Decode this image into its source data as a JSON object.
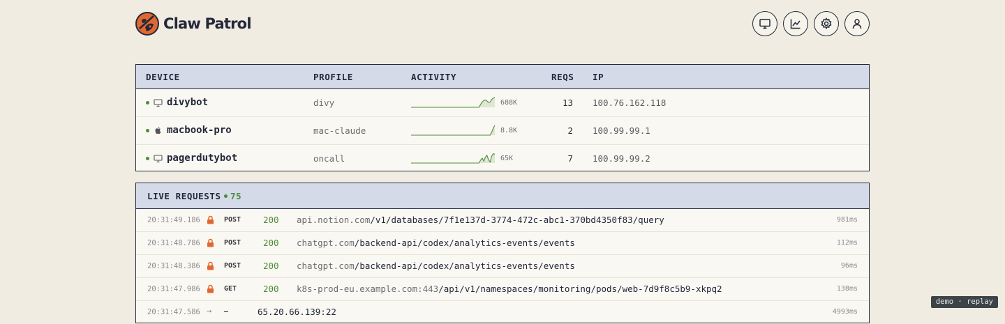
{
  "app": {
    "title": "Claw Patrol",
    "colors": {
      "brand": "#e0682f",
      "accent": "#4e8a3a",
      "ink": "#23283a",
      "header_bg": "#d4dae8"
    }
  },
  "toolbar": [
    {
      "icon": "monitor-icon"
    },
    {
      "icon": "chart-icon"
    },
    {
      "icon": "gear-icon"
    },
    {
      "icon": "user-icon"
    }
  ],
  "devices": {
    "headers": {
      "device": "DEVICE",
      "profile": "PROFILE",
      "activity": "ACTIVITY",
      "reqs": "REQS",
      "ip": "IP"
    },
    "rows": [
      {
        "icon": "monitor-icon",
        "name": "divybot",
        "profile": "divy",
        "activity": "688K",
        "reqs": "13",
        "ip": "100.76.162.118",
        "online": true,
        "spark": [
          0,
          0,
          0,
          0,
          0,
          0,
          0,
          0,
          0,
          0,
          0,
          0,
          0,
          0,
          0,
          0,
          0,
          0,
          0,
          0,
          0,
          0,
          0,
          0,
          0,
          0,
          0,
          0,
          0,
          0,
          0,
          0,
          0,
          0,
          0,
          0,
          0,
          0,
          0,
          0,
          0,
          0,
          0,
          0,
          0.3,
          0.55,
          0.7,
          0.75,
          0.65,
          0.5,
          0.55,
          0.8,
          0.95,
          1.0
        ]
      },
      {
        "icon": "apple-icon",
        "name": "macbook-pro",
        "profile": "mac-claude",
        "activity": "8.8K",
        "reqs": "2",
        "ip": "100.99.99.1",
        "online": true,
        "spark": [
          0,
          0,
          0,
          0,
          0,
          0,
          0,
          0,
          0,
          0,
          0,
          0,
          0,
          0,
          0,
          0,
          0,
          0,
          0,
          0,
          0,
          0,
          0,
          0,
          0,
          0,
          0,
          0,
          0,
          0,
          0,
          0,
          0,
          0,
          0,
          0,
          0,
          0,
          0,
          0,
          0,
          0,
          0,
          0,
          0,
          0,
          0,
          0,
          0,
          0,
          0,
          0.3,
          0.7,
          1.0
        ]
      },
      {
        "icon": "monitor-icon",
        "name": "pagerdutybot",
        "profile": "oncall",
        "activity": "65K",
        "reqs": "7",
        "ip": "100.99.99.2",
        "online": true,
        "spark": [
          0,
          0,
          0,
          0,
          0,
          0,
          0,
          0,
          0,
          0,
          0,
          0,
          0,
          0,
          0,
          0,
          0,
          0,
          0,
          0,
          0,
          0,
          0,
          0,
          0,
          0,
          0,
          0,
          0,
          0,
          0,
          0,
          0,
          0,
          0,
          0,
          0,
          0,
          0,
          0,
          0,
          0,
          0,
          0,
          0.3,
          0.5,
          0.2,
          0.6,
          0.8,
          0.35,
          0.1,
          0.7,
          0.95,
          0.9
        ]
      }
    ]
  },
  "live": {
    "title": "LIVE REQUESTS",
    "count": "75",
    "rows": [
      {
        "time": "20:31:49.186",
        "secure": true,
        "method": "POST",
        "status": "200",
        "host": "api.notion.com",
        "path": "/v1/databases/7f1e137d-3774-472c-abc1-370bd4350f83/query",
        "ms": "981ms"
      },
      {
        "time": "20:31:48.786",
        "secure": true,
        "method": "POST",
        "status": "200",
        "host": "chatgpt.com",
        "path": "/backend-api/codex/analytics-events/events",
        "ms": "112ms"
      },
      {
        "time": "20:31:48.386",
        "secure": true,
        "method": "POST",
        "status": "200",
        "host": "chatgpt.com",
        "path": "/backend-api/codex/analytics-events/events",
        "ms": "96ms"
      },
      {
        "time": "20:31:47.986",
        "secure": true,
        "method": "GET",
        "status": "200",
        "host": "k8s-prod-eu.example.com:443",
        "path": "/api/v1/namespaces/monitoring/pods/web-7d9f8c5b9-xkpq2",
        "ms": "138ms"
      },
      {
        "time": "20:31:47.586",
        "secure": false,
        "method": "—",
        "status": "",
        "host": "65.20.66.139:22",
        "path": "",
        "ms": "4993ms"
      }
    ]
  },
  "badge": "demo · replay"
}
